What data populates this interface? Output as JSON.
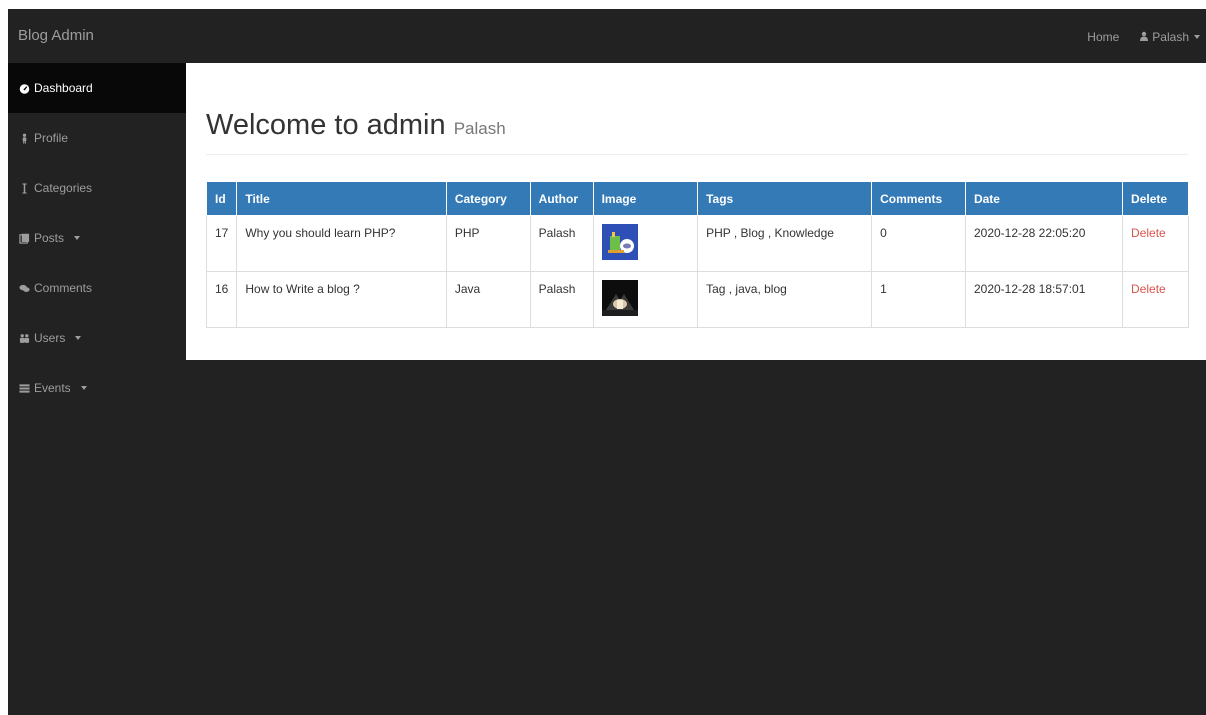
{
  "navbar": {
    "brand": "Blog Admin",
    "home": "Home",
    "user": "Palash"
  },
  "sidebar": {
    "items": [
      {
        "label": "Dashboard",
        "icon": "dashboard-icon",
        "active": true
      },
      {
        "label": "Profile",
        "icon": "profile-icon"
      },
      {
        "label": "Categories",
        "icon": "categories-icon"
      },
      {
        "label": "Posts",
        "icon": "posts-icon",
        "dropdown": true
      },
      {
        "label": "Comments",
        "icon": "comments-icon"
      },
      {
        "label": "Users",
        "icon": "users-icon",
        "dropdown": true
      },
      {
        "label": "Events",
        "icon": "events-icon",
        "dropdown": true
      }
    ]
  },
  "main": {
    "title": "Welcome to admin",
    "subtitle": "Palash",
    "table": {
      "headers": [
        "Id",
        "Title",
        "Category",
        "Author",
        "Image",
        "Tags",
        "Comments",
        "Date",
        "Delete"
      ],
      "rows": [
        {
          "id": "17",
          "title": "Why you should learn PHP?",
          "category": "PHP",
          "author": "Palash",
          "image": "php-thumbnail",
          "tags": "PHP , Blog , Knowledge",
          "comments": "0",
          "date": "2020-12-28 22:05:20",
          "delete": "Delete"
        },
        {
          "id": "16",
          "title": "How to Write a blog ?",
          "category": "Java",
          "author": "Palash",
          "image": "blog-thumbnail",
          "tags": "Tag , java, blog",
          "comments": "1",
          "date": "2020-12-28 18:57:01",
          "delete": "Delete"
        }
      ]
    }
  },
  "colors": {
    "navbar_bg": "#222222",
    "active_bg": "#080808",
    "table_header": "#337ab7",
    "delete_link": "#d9534f"
  }
}
